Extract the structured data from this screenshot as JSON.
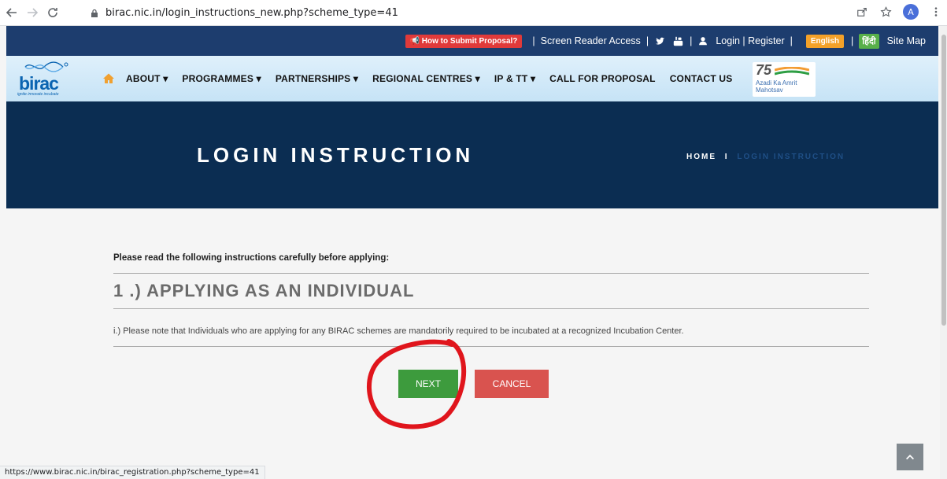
{
  "browser": {
    "url": "birac.nic.in/login_instructions_new.php?scheme_type=41",
    "avatar_letter": "A",
    "status_url": "https://www.birac.nic.in/birac_registration.php?scheme_type=41"
  },
  "topbar": {
    "how_to": "How to Submit Proposal?",
    "screen_reader": "Screen Reader Access",
    "login_register": "Login | Register",
    "english": "English",
    "hindi": "हिंदी",
    "sitemap": "Site Map"
  },
  "logo": {
    "name": "birac",
    "tagline": "ignite innovate incubate"
  },
  "nav": {
    "items": [
      {
        "label": "ABOUT ▾"
      },
      {
        "label": "PROGRAMMES ▾"
      },
      {
        "label": "PARTNERSHIPS ▾"
      },
      {
        "label": "REGIONAL CENTRES ▾"
      },
      {
        "label": "IP & TT ▾"
      },
      {
        "label": "CALL FOR PROPOSAL"
      },
      {
        "label": "CONTACT US"
      }
    ],
    "badge_75": "75",
    "badge_text": "Azadi Ka Amrit Mahotsav"
  },
  "hero": {
    "title": "LOGIN INSTRUCTION",
    "crumb_home": "HOME",
    "crumb_sep": "I",
    "crumb_current": "LOGIN INSTRUCTION"
  },
  "content": {
    "intro": "Please read the following instructions carefully before applying:",
    "section_title": "1 .)  APPLYING AS AN INDIVIDUAL",
    "note": "i.) Please note that Individuals who are applying for any BIRAC schemes are mandatorily required to be incubated at a recognized Incubation Center.",
    "next_label": "NEXT",
    "cancel_label": "CANCEL"
  },
  "colors": {
    "topbar": "#1d3d6e",
    "hero": "#0b2d52",
    "next": "#3d9b3d",
    "cancel": "#d9534f",
    "annotation": "#e0151c"
  }
}
